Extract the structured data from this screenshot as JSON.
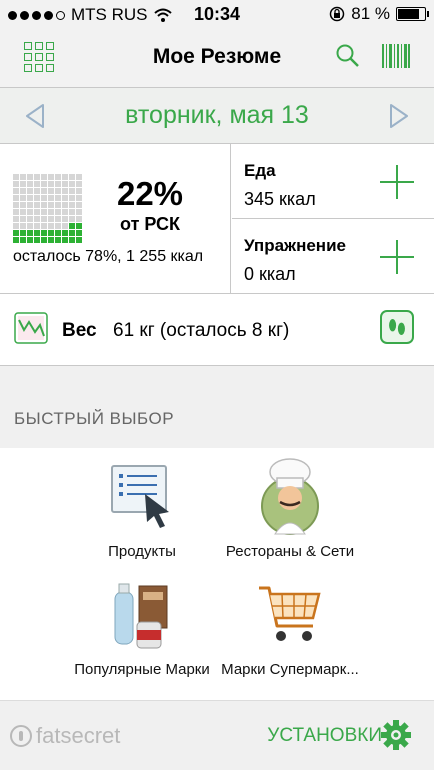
{
  "status_bar": {
    "carrier": "MTS RUS",
    "time": "10:34",
    "battery": "81 %",
    "battery_level": 0.81
  },
  "header": {
    "title": "Мое Резюме",
    "icons": [
      "grid-menu-icon",
      "search-icon",
      "barcode-icon"
    ]
  },
  "date_nav": {
    "date": "вторник, мая 13"
  },
  "summary": {
    "rdi_percent": "22%",
    "rdi_label": "от РСК",
    "remaining": "осталось 78%, 1 255 ккал",
    "rdi_fraction": 0.22,
    "food": {
      "title": "Еда",
      "value": "345 ккал"
    },
    "exercise": {
      "title": "Упражнение",
      "value": "0 ккал"
    }
  },
  "weight": {
    "label": "Вес",
    "value": "61 кг (осталось 8 кг)"
  },
  "quick_picks": {
    "heading": "БЫСТРЫЙ ВЫБОР",
    "items": [
      {
        "label": "Продукты",
        "icon": "list-cursor-icon"
      },
      {
        "label": "Рестораны & Сети",
        "icon": "chef-icon"
      },
      {
        "label": "Популярные Марки",
        "icon": "grocery-products-icon"
      },
      {
        "label": "Марки Супермарк...",
        "icon": "shopping-cart-icon"
      }
    ]
  },
  "footer": {
    "logo": "fatsecret",
    "settings": "УСТАНОВКИ"
  },
  "colors": {
    "accent": "#3aa84a",
    "progress_on": "#2db134",
    "progress_off": "#d6d6d6"
  }
}
